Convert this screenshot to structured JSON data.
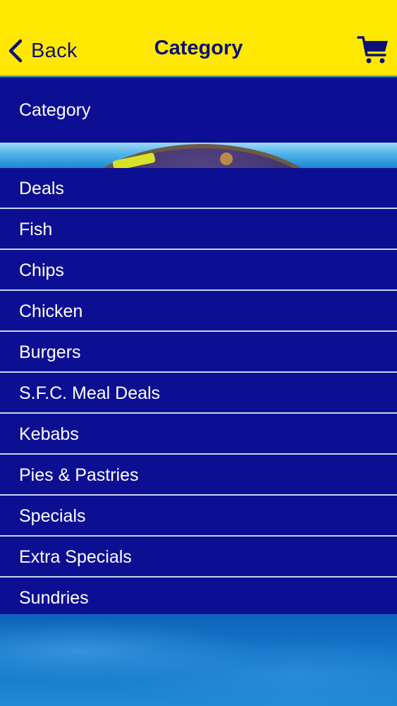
{
  "navbar": {
    "back_label": "Back",
    "title": "Category",
    "back_icon": "chevron-left-icon",
    "cart_icon": "cart-icon"
  },
  "header": {
    "label": "Category"
  },
  "categories": [
    "Deals",
    "Fish",
    "Chips",
    "Chicken",
    "Burgers",
    "S.F.C. Meal Deals",
    "Kebabs",
    "Pies & Pastries",
    "Specials",
    "Extra Specials",
    "Sundries"
  ],
  "colors": {
    "navbar": "#ffe800",
    "nav_text": "#0d1173",
    "row_bg": "#0d0f93",
    "row_text": "#ffffff",
    "divider": "#c9d3ee"
  }
}
